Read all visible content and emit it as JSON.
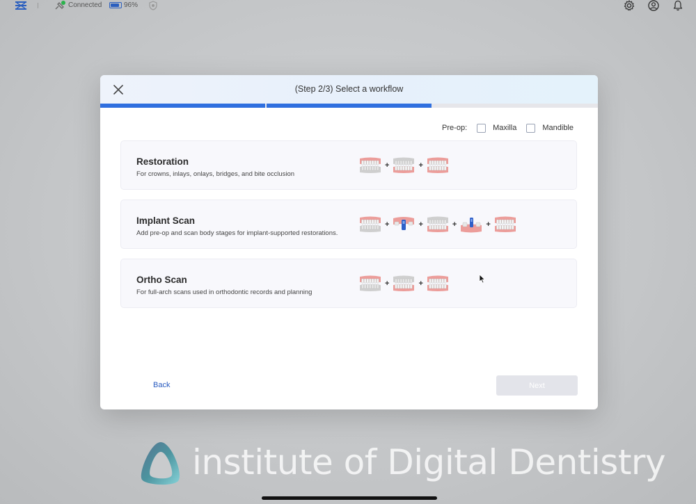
{
  "status_bar": {
    "connection": "Connected",
    "battery": "96%",
    "battery_level": 0.96,
    "icons": [
      "app-logo-icon",
      "plug-icon",
      "battery-icon",
      "shield-icon",
      "gear-icon",
      "user-icon",
      "bell-icon"
    ]
  },
  "modal": {
    "title": "(Step 2/3) Select a workflow",
    "progress_segments_complete": 2,
    "progress_segments_total": 3,
    "preop": {
      "label": "Pre-op:",
      "options": [
        {
          "label": "Maxilla",
          "checked": false
        },
        {
          "label": "Mandible",
          "checked": false
        }
      ]
    },
    "workflows": [
      {
        "title": "Restoration",
        "description": "For crowns, inlays, onlays, bridges, and bite occlusion",
        "stages": [
          "upper-arch-icon",
          "lower-arch-icon",
          "bite-icon"
        ]
      },
      {
        "title": "Implant Scan",
        "description": "Add pre-op and scan body stages for implant-supported restorations.",
        "stages": [
          "upper-arch-icon",
          "scan-body-icon",
          "lower-arch-icon",
          "implant-icon",
          "bite-icon"
        ]
      },
      {
        "title": "Ortho Scan",
        "description": "For full-arch scans used in orthodontic records and planning",
        "stages": [
          "upper-arch-icon",
          "lower-arch-icon",
          "bite-icon"
        ]
      }
    ],
    "plus_symbol": "+",
    "back_label": "Back",
    "next_label": "Next"
  },
  "watermark": {
    "text": "institute of Digital Dentistry"
  },
  "colors": {
    "accent": "#2f6fdf",
    "link": "#2a5cc0",
    "gum": "#ec9d9a",
    "tooth": "#f4f4f4"
  }
}
